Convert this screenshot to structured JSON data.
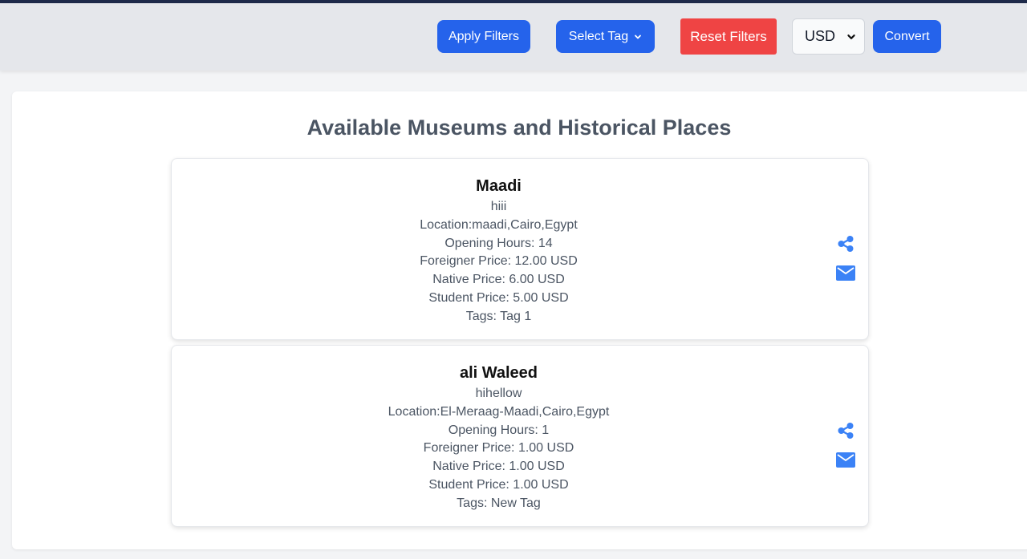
{
  "toolbar": {
    "apply_label": "Apply Filters",
    "tag_label": "Select Tag",
    "reset_label": "Reset Filters",
    "currency_value": "USD",
    "convert_label": "Convert"
  },
  "page": {
    "title": "Available Museums and Historical Places"
  },
  "places": [
    {
      "name": "Maadi",
      "description": "hiii",
      "location": "Location:maadi,Cairo,Egypt",
      "opening_hours": "Opening Hours: 14",
      "foreigner_price": "Foreigner Price: 12.00 USD",
      "native_price": "Native Price: 6.00 USD",
      "student_price": "Student Price: 5.00 USD",
      "tags": "Tags: Tag 1"
    },
    {
      "name": "ali Waleed",
      "description": "hihellow",
      "location": "Location:El-Meraag-Maadi,Cairo,Egypt",
      "opening_hours": "Opening Hours: 1",
      "foreigner_price": "Foreigner Price: 1.00 USD",
      "native_price": "Native Price: 1.00 USD",
      "student_price": "Student Price: 1.00 USD",
      "tags": "Tags: New Tag"
    }
  ],
  "colors": {
    "primary": "#2563eb",
    "danger": "#ef4444",
    "icon": "#3b82f6"
  },
  "icons": {
    "share": "share-icon",
    "mail": "envelope-icon",
    "chevron": "chevron-down-icon"
  }
}
